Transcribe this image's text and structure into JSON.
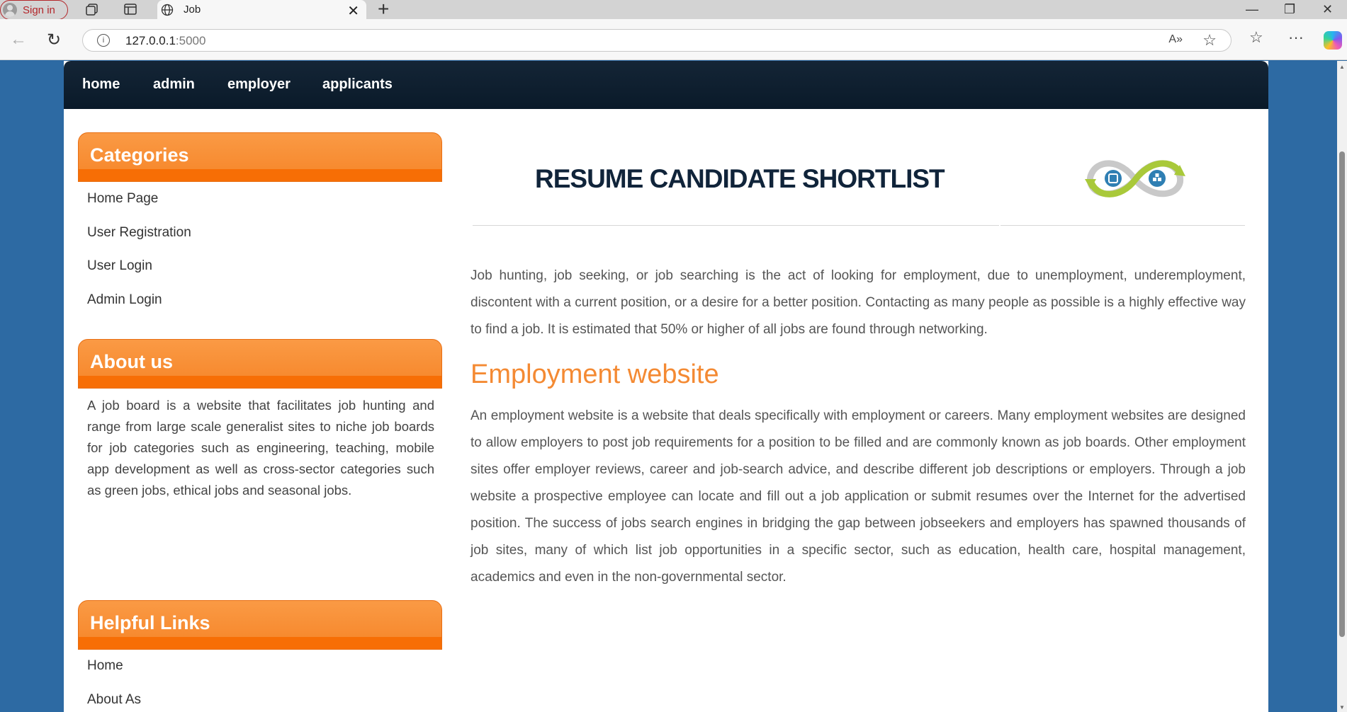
{
  "browser": {
    "signin_label": "Sign in",
    "tab_title": "Job",
    "url_host": "127.0.0.1",
    "url_port": ":5000"
  },
  "nav": {
    "items": [
      "home",
      "admin",
      "employer",
      "applicants"
    ]
  },
  "sidebar": {
    "categories": {
      "title": "Categories",
      "links": [
        "Home Page",
        "User Registration",
        "User Login",
        "Admin Login"
      ]
    },
    "about": {
      "title": "About us",
      "text": "A job board is a website that facilitates job hunting and range from large scale generalist sites to niche job boards for job categories such as engineering, teaching, mobile app development as well as cross-sector categories such as green jobs, ethical jobs and seasonal jobs."
    },
    "helpful": {
      "title": "Helpful Links",
      "links": [
        "Home",
        "About As"
      ]
    }
  },
  "main": {
    "title": "RESUME CANDIDATE SHORTLIST",
    "intro": "Job hunting, job seeking, or job searching is the act of looking for employment, due to unemployment, underemployment, discontent with a current position, or a desire for a better position. Contacting as many people as possible is a highly effective way to find a job. It is estimated that 50% or higher of all jobs are found through networking.",
    "subheading": "Employment website",
    "body": "An employment website is a website that deals specifically with employment or careers. Many employment websites are designed to allow employers to post job requirements for a position to be filled and are commonly known as job boards. Other employment sites offer employer reviews, career and job-search advice, and describe different job descriptions or employers. Through a job website a prospective employee can locate and fill out a job application or submit resumes over the Internet for the advertised position. The success of jobs search engines in bridging the gap between jobseekers and employers has spawned thousands of job sites, many of which list job opportunities in a specific sector, such as education, health care, hospital management, academics and even in the non-governmental sector."
  },
  "colors": {
    "accent_orange": "#f78a2f",
    "nav_bg": "#0a1a29",
    "page_bg": "#2d6aa3",
    "heading_dark": "#10243a"
  }
}
